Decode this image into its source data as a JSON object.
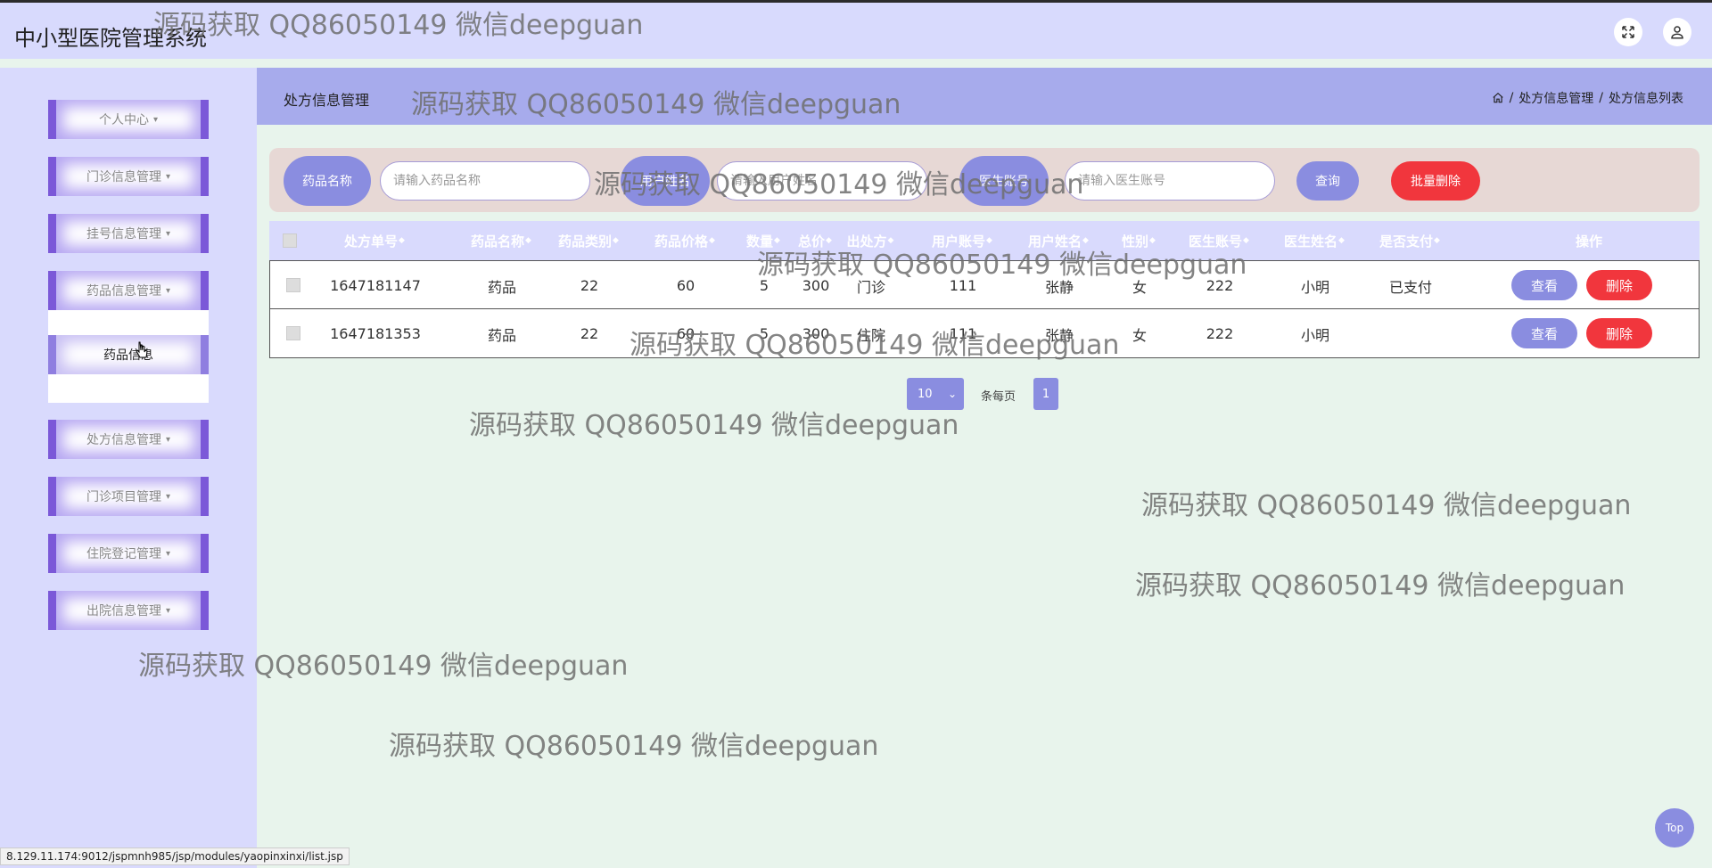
{
  "app": {
    "title": "中小型医院管理系统"
  },
  "topbar": {
    "fullscreen_icon": "fullscreen-icon",
    "user_icon": "user-icon"
  },
  "sidebar": {
    "items": [
      {
        "label": "个人中心"
      },
      {
        "label": "门诊信息管理"
      },
      {
        "label": "挂号信息管理"
      },
      {
        "label": "药品信息管理"
      },
      {
        "label": "处方信息管理"
      },
      {
        "label": "门诊项目管理"
      },
      {
        "label": "住院登记管理"
      },
      {
        "label": "出院信息管理"
      }
    ],
    "caret": "▾",
    "submenu": {
      "label": "药品信息"
    }
  },
  "header": {
    "title": "处方信息管理",
    "breadcrumb": [
      "处方信息管理",
      "处方信息列表"
    ],
    "separator": "/"
  },
  "search": {
    "drug_name_label": "药品名称",
    "drug_name_placeholder": "请输入药品名称",
    "user_name_label": "用户姓名",
    "user_name_placeholder": "请输入用户姓名",
    "doctor_account_label": "医生账号",
    "doctor_account_placeholder": "请输入医生账号",
    "query_label": "查询",
    "batch_delete_label": "批量删除"
  },
  "table": {
    "sort_glyph": "◆",
    "columns": [
      "处方单号",
      "药品名称",
      "药品类别",
      "药品价格",
      "数量",
      "总价",
      "出处方",
      "用户账号",
      "用户姓名",
      "性别",
      "医生账号",
      "医生姓名",
      "是否支付",
      "操作"
    ],
    "rows": [
      {
        "id": "1647181147",
        "drug": "药品",
        "category": "22",
        "price": "60",
        "qty": "5",
        "total": "300",
        "type": "门诊",
        "user_account": "111",
        "user_name": "张静",
        "gender": "女",
        "doctor_account": "222",
        "doctor_name": "小明",
        "paid": "已支付"
      },
      {
        "id": "1647181353",
        "drug": "药品",
        "category": "22",
        "price": "60",
        "qty": "5",
        "total": "300",
        "type": "住院",
        "user_account": "111",
        "user_name": "张静",
        "gender": "女",
        "doctor_account": "222",
        "doctor_name": "小明",
        "paid": ""
      }
    ],
    "view_label": "查看",
    "delete_label": "删除"
  },
  "pagination": {
    "page_size": "10",
    "per_page_label": "条每页",
    "current_page": "1"
  },
  "top_button": "Top",
  "status_url": "8.129.11.174:9012/jspmnh985/jsp/modules/yaopinxinxi/list.jsp",
  "watermark": "源码获取 QQ86050149 微信deepguan"
}
